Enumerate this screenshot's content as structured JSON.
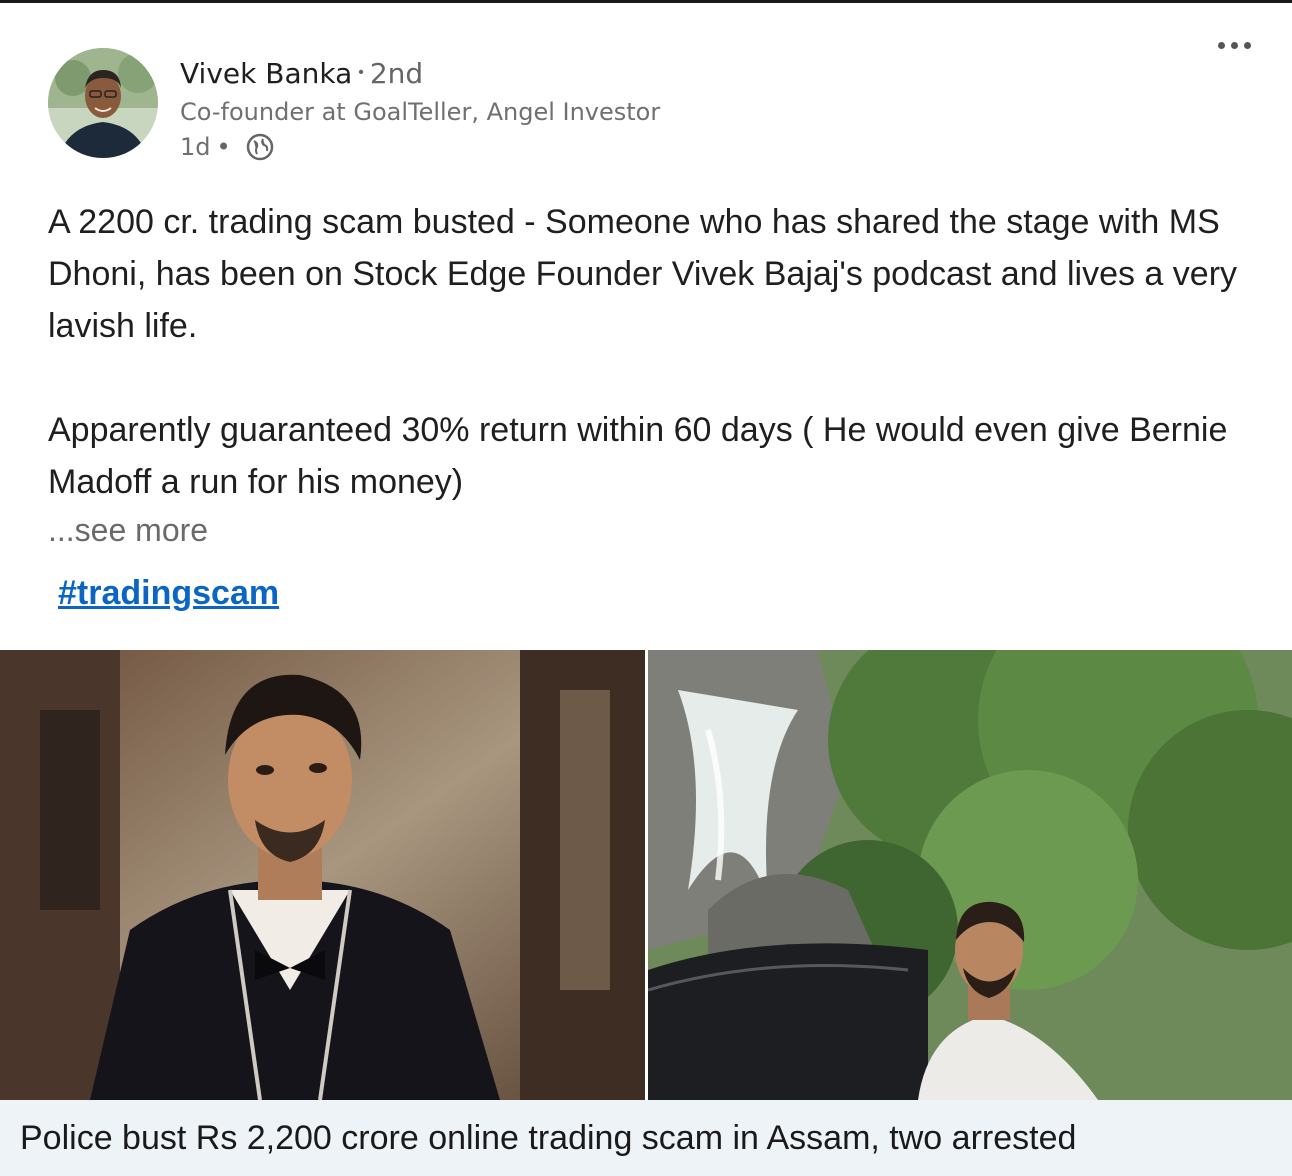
{
  "post": {
    "author": {
      "name": "Vivek Banka",
      "degree": "2nd",
      "headline": "Co-founder at GoalTeller, Angel Investor",
      "time": "1d"
    },
    "paragraphs": [
      "A 2200 cr. trading scam busted - Someone who has shared the stage with MS Dhoni, has been on Stock Edge Founder Vivek Bajaj's podcast and lives a very lavish life.",
      "Apparently guaranteed 30% return within 60 days ( He would even give Bernie Madoff a run for his money)"
    ],
    "see_more": "...see more",
    "hashtag": "#tradingscam",
    "link_preview": {
      "title": "Police bust Rs 2,200 crore online trading scam in Assam, two arrested"
    }
  },
  "icons": {
    "visibility": "globe-icon",
    "menu": "more-horizontal-icon"
  },
  "colors": {
    "link": "#0a66c2",
    "muted": "#707070",
    "caption_bg": "#eef3f8"
  }
}
